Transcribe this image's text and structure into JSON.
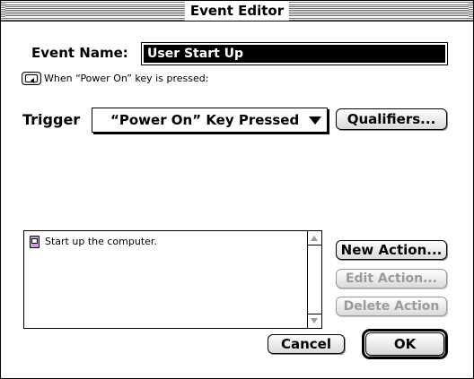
{
  "window": {
    "title": "Event Editor"
  },
  "event_name": {
    "label": "Event Name:",
    "value": "User Start Up"
  },
  "hint": {
    "icon": "power-key-icon",
    "text": "When “Power On” key is pressed:"
  },
  "trigger": {
    "label": "Trigger",
    "selected": "“Power On” Key Pressed",
    "qualifiers_label": "Qualifiers..."
  },
  "actions": {
    "items": [
      {
        "icon": "computer-script-icon",
        "label": "Start up the computer."
      }
    ],
    "new_label": "New Action...",
    "edit_label": "Edit Action...",
    "delete_label": "Delete Action"
  },
  "footer": {
    "cancel_label": "Cancel",
    "ok_label": "OK"
  }
}
